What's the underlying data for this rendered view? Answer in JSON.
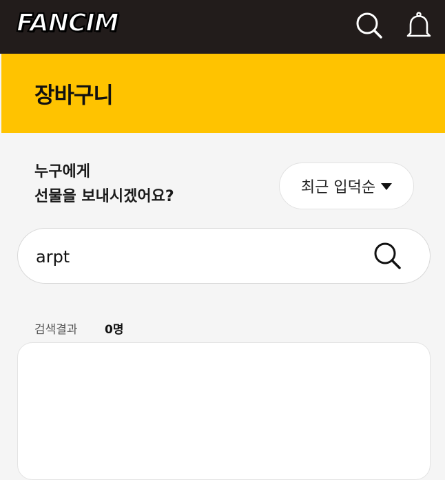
{
  "header": {
    "logo_text": "FANCIM",
    "icons": [
      "search-icon",
      "bell-icon"
    ]
  },
  "banner": {
    "title": "장바구니",
    "background": "#ffc300"
  },
  "gift": {
    "question_line1": "누구에게",
    "question_line2": "선물을 보내시겠어요?"
  },
  "sort": {
    "selected": "최근 입덕순"
  },
  "search": {
    "value": "arpt"
  },
  "results": {
    "label": "검색결과",
    "count": "0명"
  },
  "colors": {
    "topbar": "#221c1b",
    "accent": "#ffc300",
    "page": "#f5f5f5"
  }
}
